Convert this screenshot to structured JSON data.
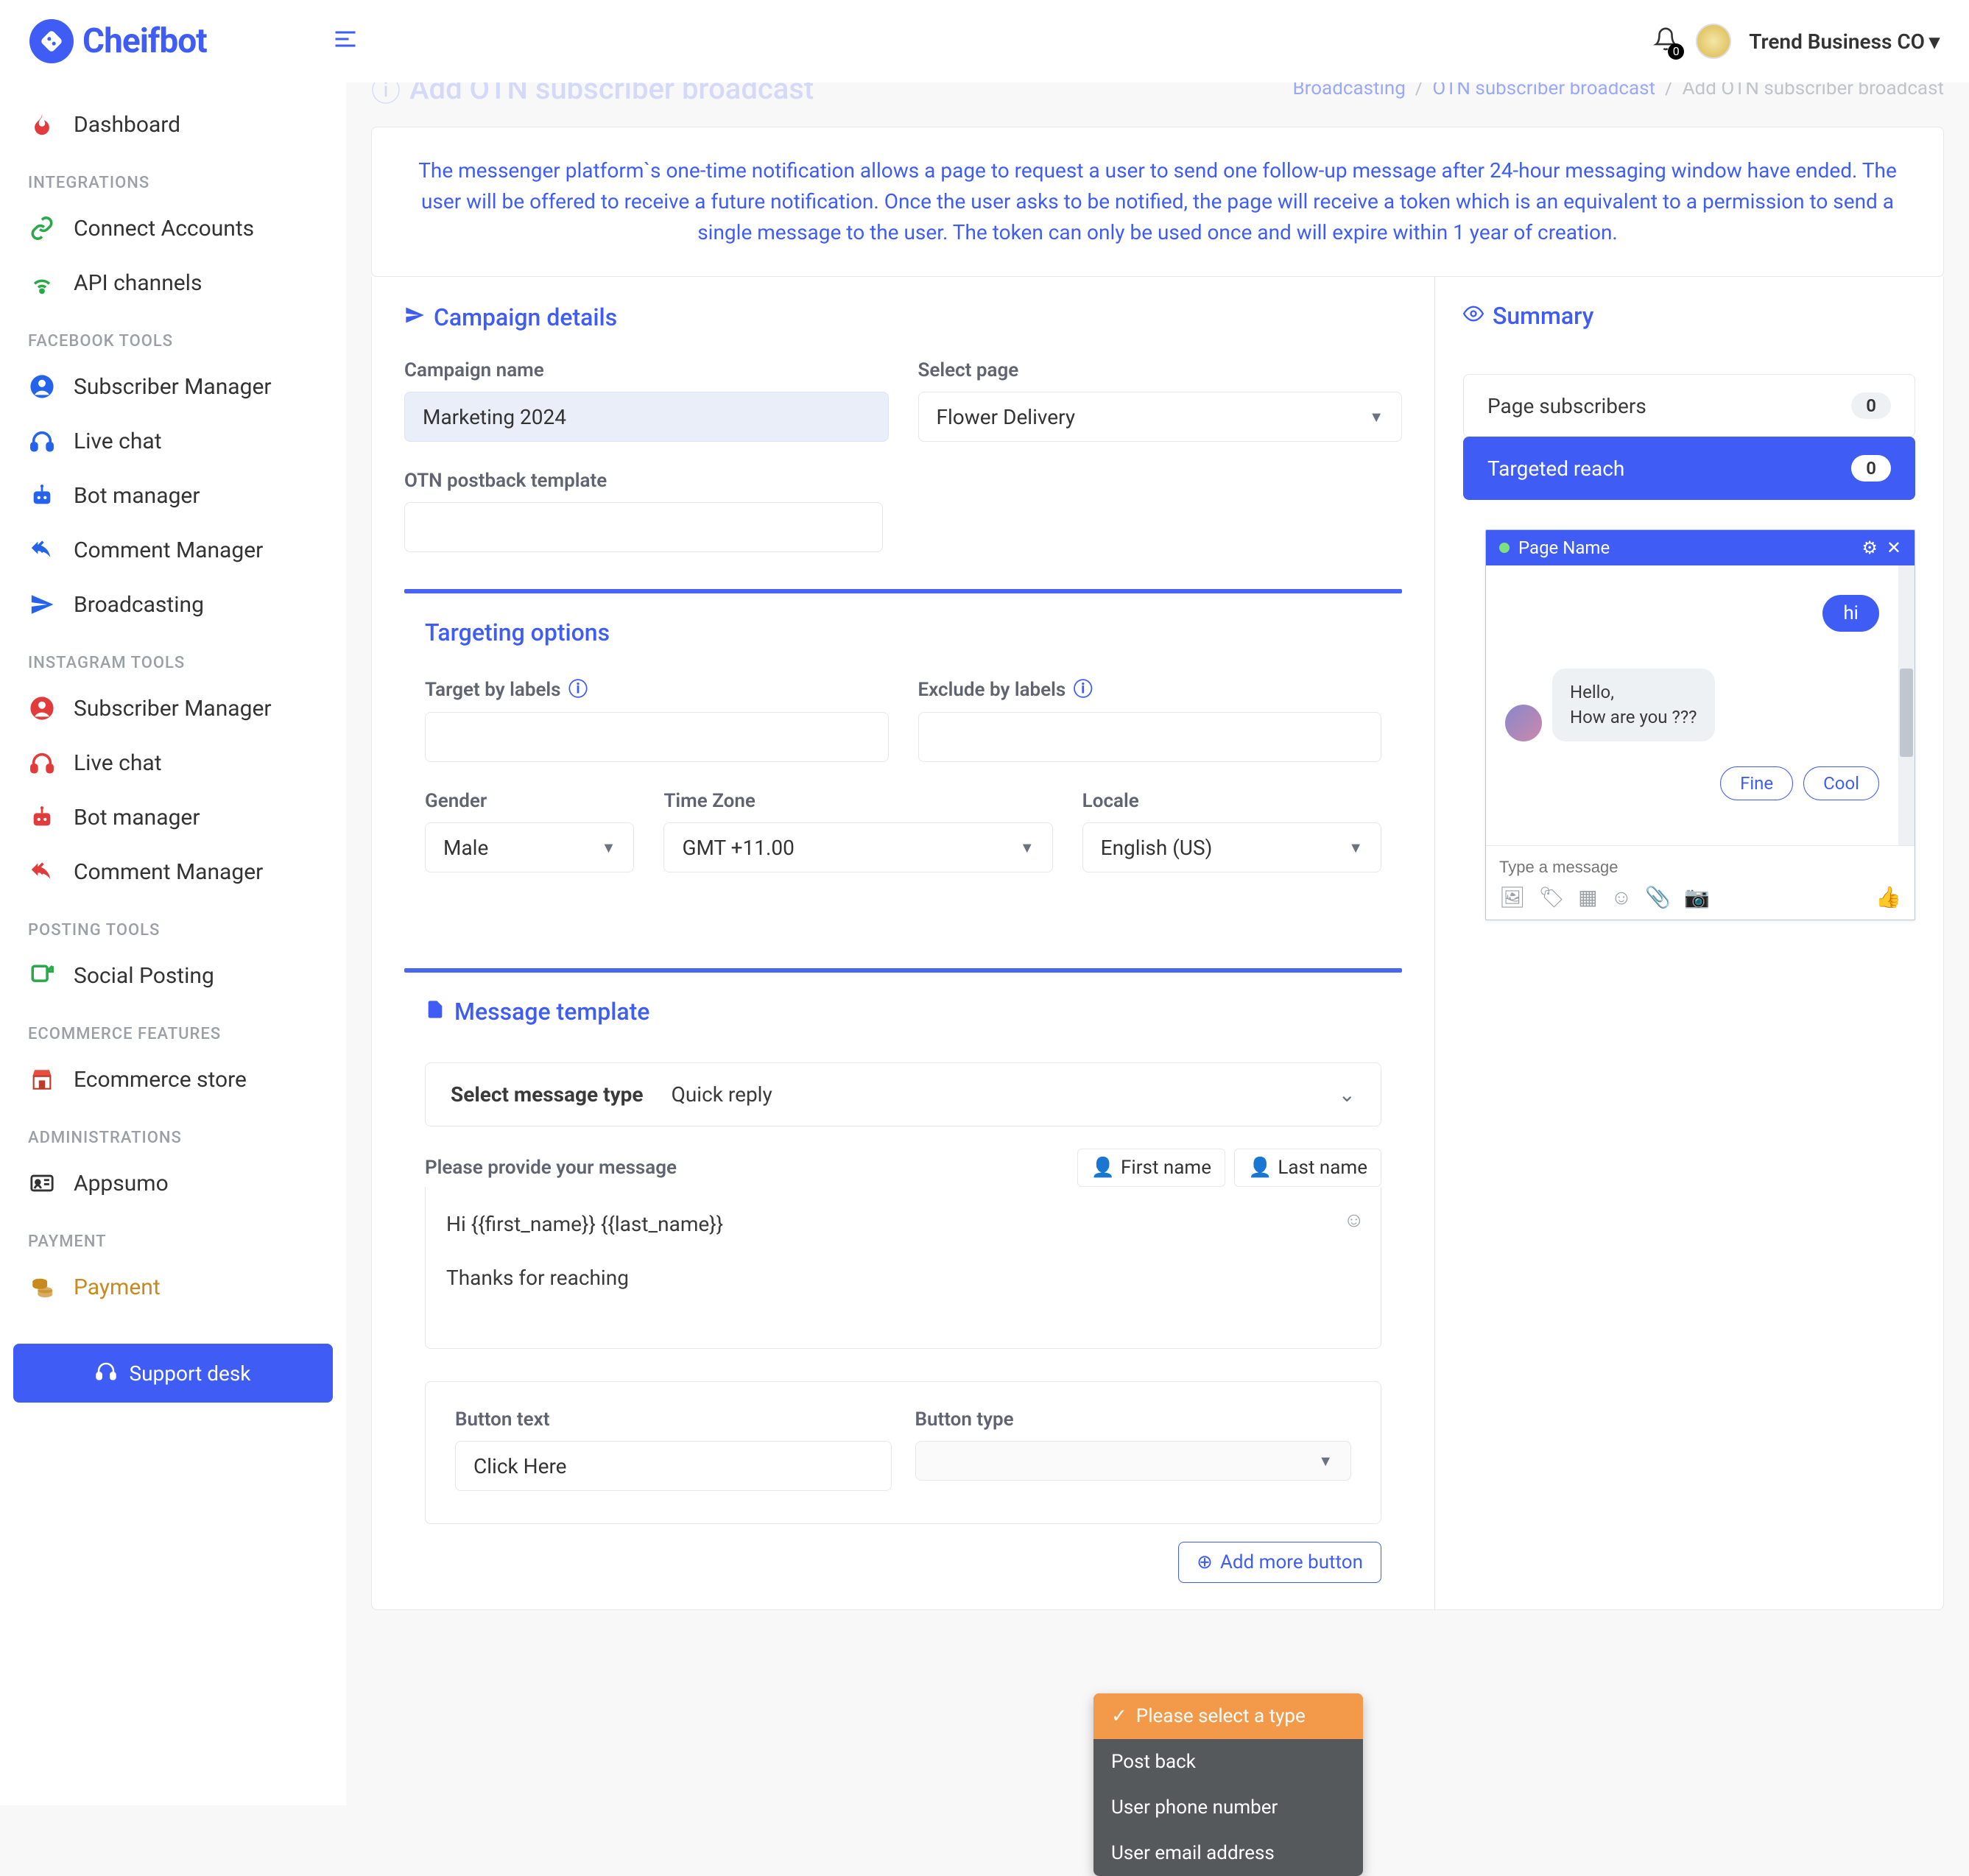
{
  "brand": {
    "name": "Cheifbot"
  },
  "header": {
    "notifications_count": "0",
    "account_name": "Trend Business CO"
  },
  "sidebar": {
    "items": [
      {
        "label": "Dashboard",
        "icon": "flame",
        "color": "#e23b3b"
      }
    ],
    "groups": [
      {
        "heading": "INTEGRATIONS",
        "items": [
          {
            "label": "Connect Accounts",
            "icon": "link",
            "color": "#2aa84a"
          },
          {
            "label": "API channels",
            "icon": "wifi",
            "color": "#2aa84a"
          }
        ]
      },
      {
        "heading": "FACEBOOK TOOLS",
        "items": [
          {
            "label": "Subscriber Manager",
            "icon": "user-circle",
            "color": "#2563eb"
          },
          {
            "label": "Live chat",
            "icon": "headset",
            "color": "#2563eb"
          },
          {
            "label": "Bot manager",
            "icon": "robot",
            "color": "#2563eb"
          },
          {
            "label": "Comment Manager",
            "icon": "reply-all",
            "color": "#2563eb"
          },
          {
            "label": "Broadcasting",
            "icon": "send",
            "color": "#2563eb"
          }
        ]
      },
      {
        "heading": "INSTAGRAM TOOLS",
        "items": [
          {
            "label": "Subscriber Manager",
            "icon": "user-circle",
            "color": "#e23b3b"
          },
          {
            "label": "Live chat",
            "icon": "headset",
            "color": "#e23b3b"
          },
          {
            "label": "Bot manager",
            "icon": "robot",
            "color": "#e23b3b"
          },
          {
            "label": "Comment Manager",
            "icon": "reply-all",
            "color": "#e23b3b"
          }
        ]
      },
      {
        "heading": "POSTING TOOLS",
        "items": [
          {
            "label": "Social Posting",
            "icon": "share",
            "color": "#2aa84a"
          }
        ]
      },
      {
        "heading": "ECOMMERCE FEATURES",
        "items": [
          {
            "label": "Ecommerce store",
            "icon": "store",
            "color": "#c0392b"
          }
        ]
      },
      {
        "heading": "ADMINISTRATIONS",
        "items": [
          {
            "label": "Appsumo",
            "icon": "id-card",
            "color": "#333"
          }
        ]
      },
      {
        "heading": "PAYMENT",
        "items": [
          {
            "label": "Payment",
            "icon": "coins",
            "color": "#c78a1f",
            "active": true
          }
        ]
      }
    ],
    "support_label": "Support desk"
  },
  "page": {
    "title": "Add OTN subscriber broadcast",
    "breadcrumb": {
      "a": "Broadcasting",
      "b": "OTN subscriber broadcast",
      "c": "Add OTN subscriber broadcast"
    },
    "info": "The messenger platform`s one-time notification allows a page to request a user to send one follow-up message after 24-hour messaging window have ended. The user will be offered to receive a future notification. Once the user asks to be notified, the page will receive a token which is an equivalent to a permission to send a single message to the user. The token can only be used once and will expire within 1 year of creation."
  },
  "campaign": {
    "section_title": "Campaign details",
    "name_label": "Campaign name",
    "name_value": "Marketing 2024",
    "page_label": "Select page",
    "page_value": "Flower Delivery",
    "otn_label": "OTN postback template",
    "otn_value": ""
  },
  "targeting": {
    "section_title": "Targeting options",
    "by_labels_label": "Target by labels",
    "exclude_label": "Exclude by labels",
    "gender_label": "Gender",
    "gender_value": "Male",
    "tz_label": "Time Zone",
    "tz_value": "GMT +11.00",
    "locale_label": "Locale",
    "locale_value": "English (US)"
  },
  "summary": {
    "title": "Summary",
    "rows": [
      {
        "label": "Page subscribers",
        "value": "0"
      },
      {
        "label": "Targeted reach",
        "value": "0"
      }
    ]
  },
  "chat": {
    "page_name": "Page Name",
    "out_msg": "hi",
    "in_line1": "Hello,",
    "in_line2": "How are you  ???",
    "qr1": "Fine",
    "qr2": "Cool",
    "placeholder": "Type a message"
  },
  "template": {
    "section_title": "Message template",
    "select_label": "Select message type",
    "select_value": "Quick reply",
    "provide_label": "Please provide your message",
    "first_name": "First name",
    "last_name": "Last name",
    "message_line1": "Hi  {{first_name}} {{last_name}}",
    "message_line2": "Thanks for reaching",
    "button_text_label": "Button text",
    "button_text_value": "Click Here",
    "button_type_label": "Button type",
    "add_more": "Add more button"
  },
  "dropdown": {
    "opt_selected": "Please select a type",
    "opt1": "Post back",
    "opt2": "User phone number",
    "opt3": "User email address"
  }
}
